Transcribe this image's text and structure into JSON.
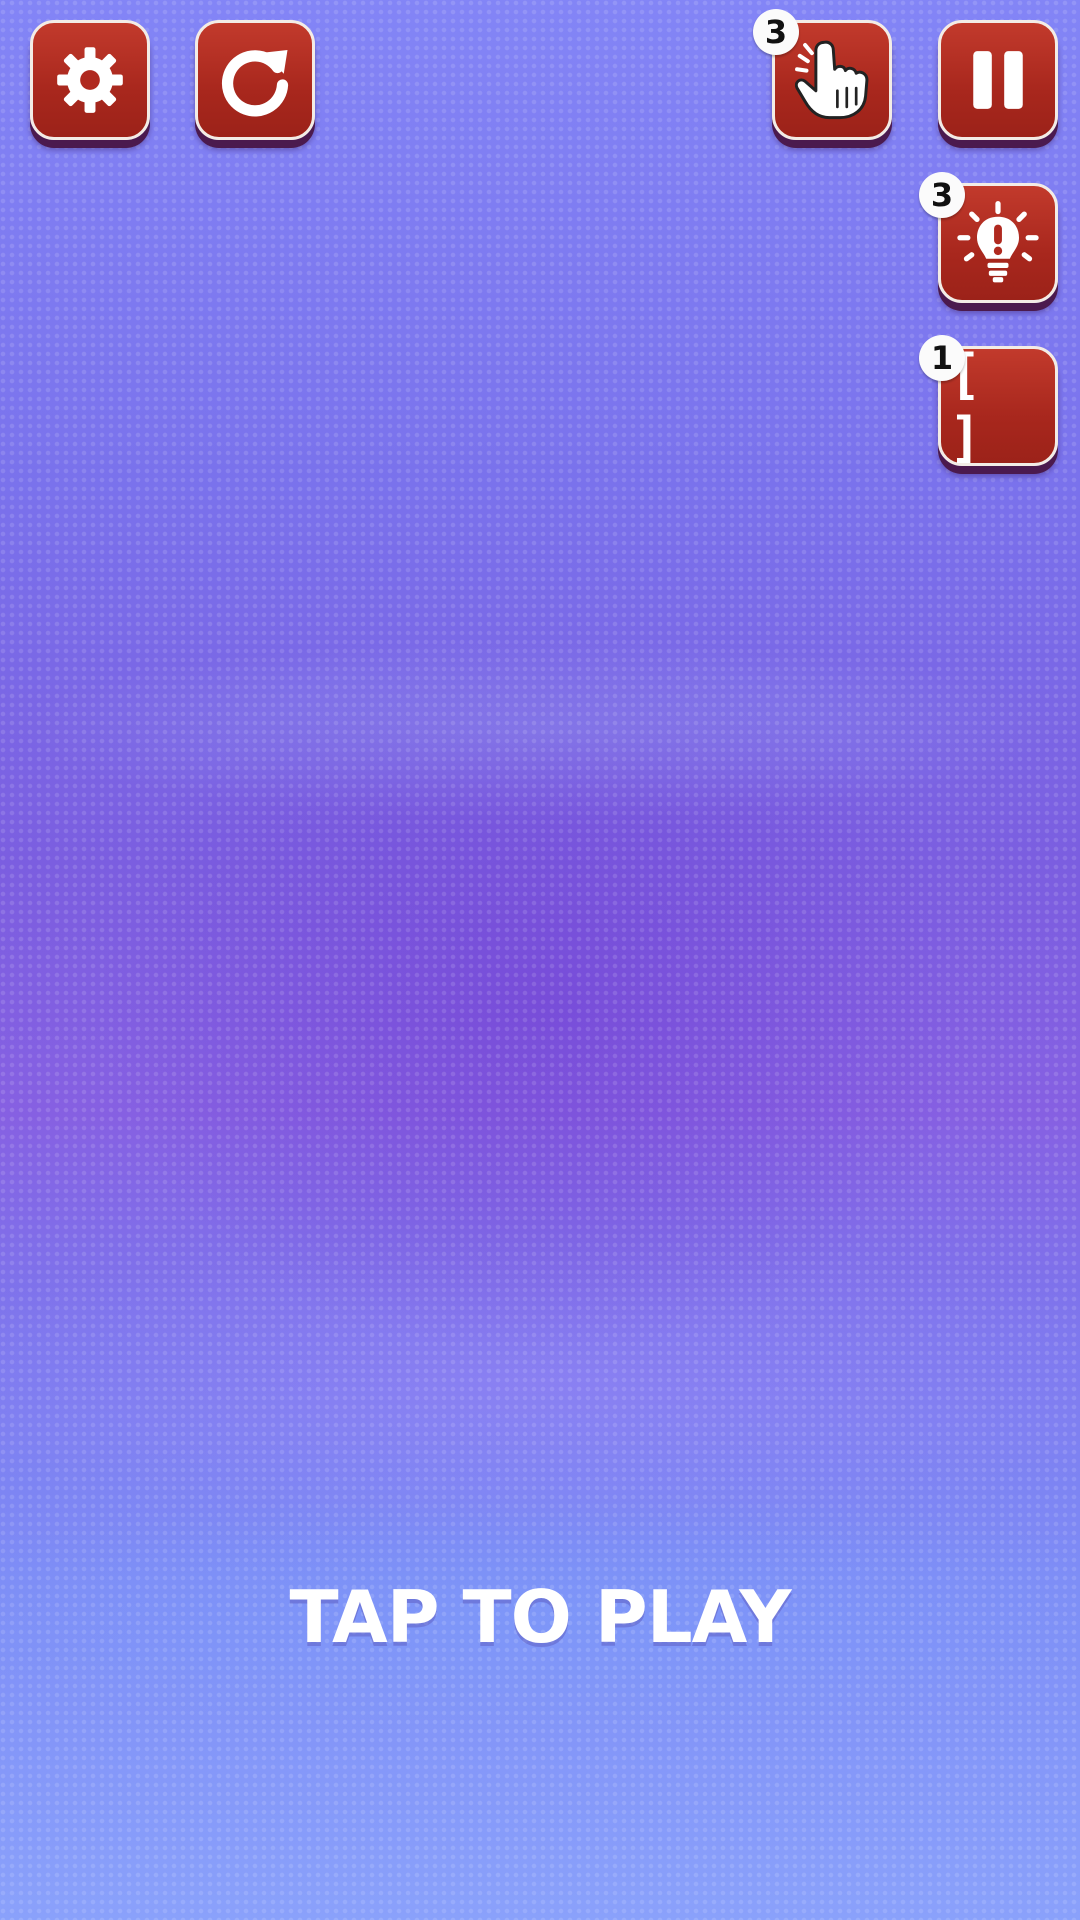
{
  "top_bar": {
    "settings": {
      "icon": "gear-icon"
    },
    "restart": {
      "icon": "restart-icon"
    },
    "hand_hint": {
      "icon": "pointing-hand-icon",
      "count": "3"
    },
    "pause": {
      "icon": "pause-icon"
    }
  },
  "side_tools": {
    "hint": {
      "icon": "lightbulb-icon",
      "count": "3"
    },
    "bracket": {
      "label": "[ ]",
      "count": "1"
    }
  },
  "prompt": {
    "text": "TAP TO PLAY"
  },
  "colors": {
    "button_red": "#b0291f",
    "button_border": "#f3ece6",
    "button_shadow": "#4b1a4e",
    "background_top": "#8385f6",
    "background_mid": "#7b5ee0",
    "background_bottom": "#8aa1fb"
  }
}
